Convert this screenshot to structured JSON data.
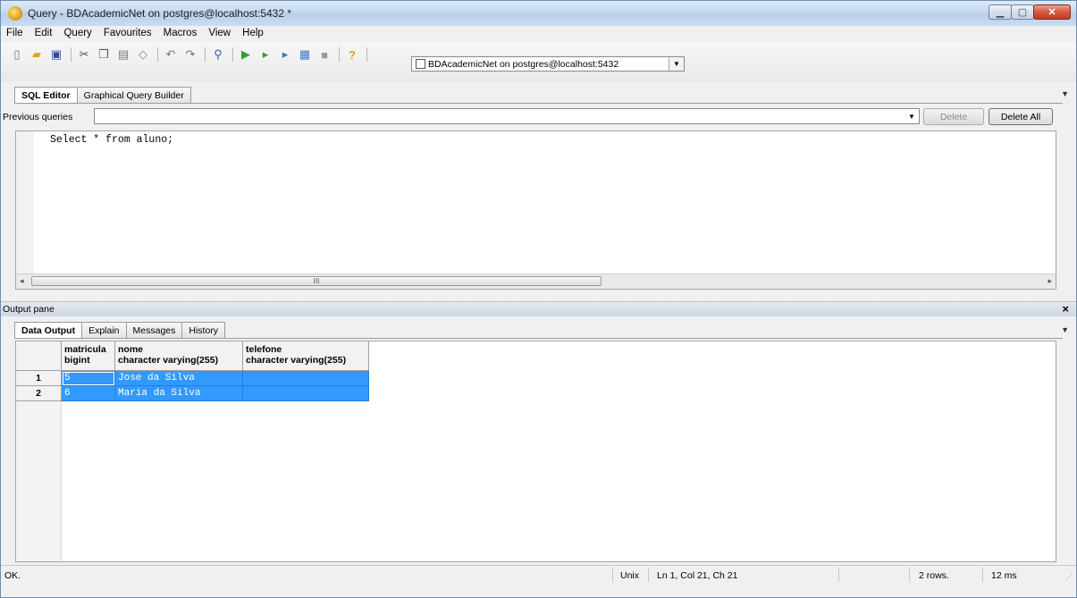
{
  "window": {
    "title": "Query - BDAcademicNet on postgres@localhost:5432 *",
    "minimize_icon": "minimize-icon",
    "maximize_icon": "maximize-icon",
    "close_icon": "close-icon"
  },
  "menu": {
    "file": "File",
    "edit": "Edit",
    "query": "Query",
    "favourites": "Favourites",
    "macros": "Macros",
    "view": "View",
    "help": "Help"
  },
  "toolbar": {
    "connection": "BDAcademicNet on postgres@localhost:5432"
  },
  "editor_tabs": {
    "sql_editor": "SQL Editor",
    "graphical": "Graphical Query Builder"
  },
  "previous": {
    "label": "Previous queries",
    "delete": "Delete",
    "delete_all": "Delete All"
  },
  "editor": {
    "code": "Select * from aluno;",
    "scroll_mark": "III"
  },
  "output": {
    "label": "Output pane",
    "close": "×",
    "tabs": {
      "data_output": "Data Output",
      "explain": "Explain",
      "messages": "Messages",
      "history": "History"
    },
    "columns": [
      {
        "name": "matricula",
        "type": "bigint"
      },
      {
        "name": "nome",
        "type": "character varying(255)"
      },
      {
        "name": "telefone",
        "type": "character varying(255)"
      }
    ],
    "rows": [
      {
        "num": "1",
        "matricula": "5",
        "nome": "Jose da Silva",
        "telefone": ""
      },
      {
        "num": "2",
        "matricula": "6",
        "nome": "Maria da Silva",
        "telefone": ""
      }
    ]
  },
  "status": {
    "message": "OK.",
    "line_ending": "Unix",
    "position": "Ln 1, Col 21, Ch 21",
    "rows": "2 rows.",
    "time": "12 ms"
  },
  "colors": {
    "selection": "#3399ff",
    "titlebar": "#c6daf0"
  }
}
